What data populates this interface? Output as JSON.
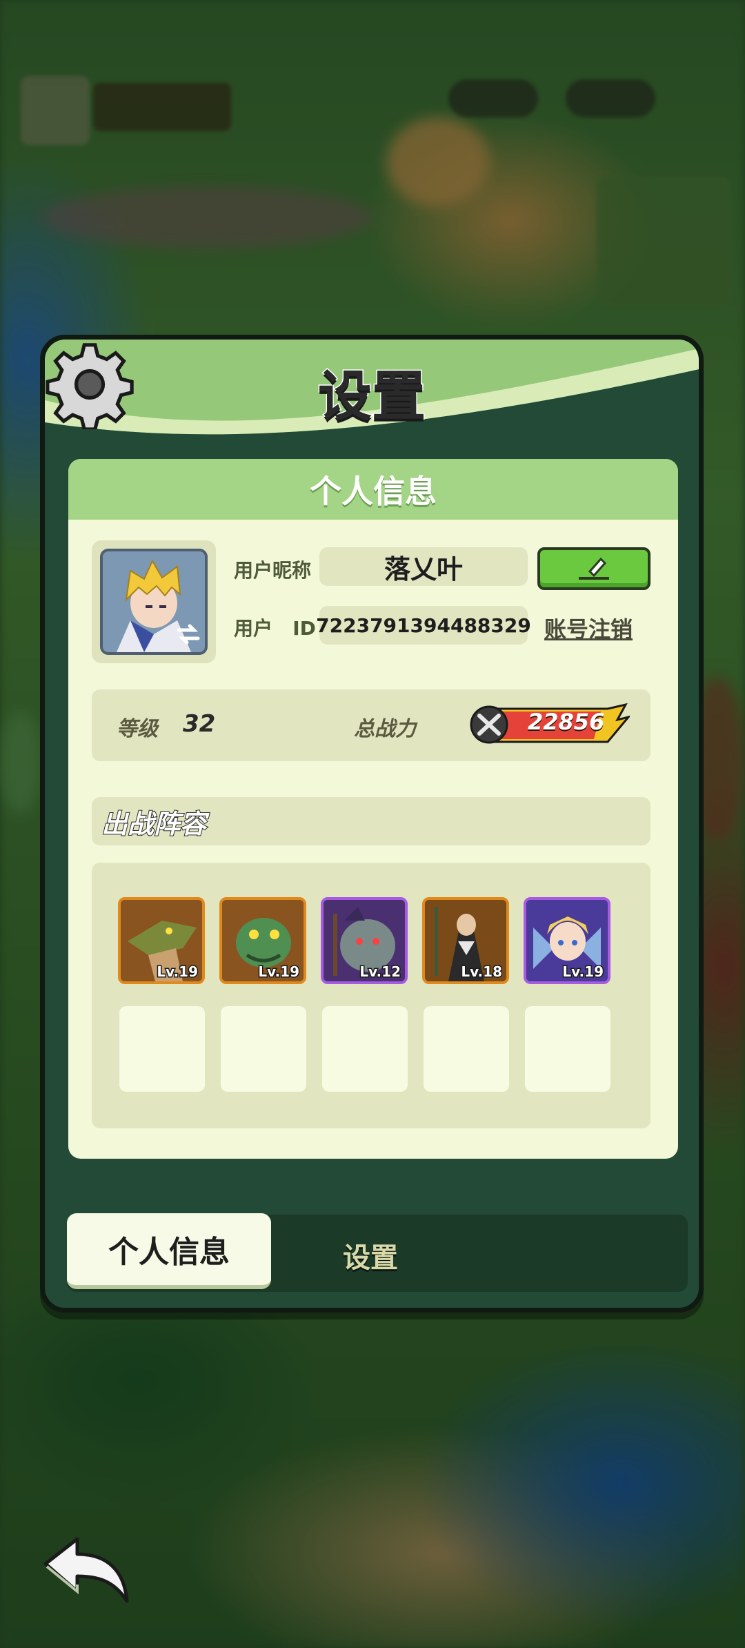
{
  "dialog": {
    "title": "设置",
    "section_title": "个人信息"
  },
  "profile": {
    "nickname_label": "用户昵称",
    "nickname": "落乂叶",
    "id_label": "用户",
    "id_suffix": "ID",
    "user_id": "7223791394488329",
    "account_cancel": "账号注销"
  },
  "stats": {
    "level_label": "等级",
    "level": "32",
    "power_label": "总战力",
    "power": "22856"
  },
  "lineup": {
    "title": "出战阵容",
    "heroes": [
      {
        "level": "Lv.19",
        "rarity": "orange"
      },
      {
        "level": "Lv.19",
        "rarity": "orange"
      },
      {
        "level": "Lv.12",
        "rarity": "purple"
      },
      {
        "level": "Lv.18",
        "rarity": "orange"
      },
      {
        "level": "Lv.19",
        "rarity": "purple"
      }
    ]
  },
  "tabs": {
    "active": "个人信息",
    "inactive": "设置"
  },
  "colors": {
    "accent_green": "#6bc93f",
    "panel_bg": "#f2f8d8",
    "dialog_bg": "#224a36"
  }
}
